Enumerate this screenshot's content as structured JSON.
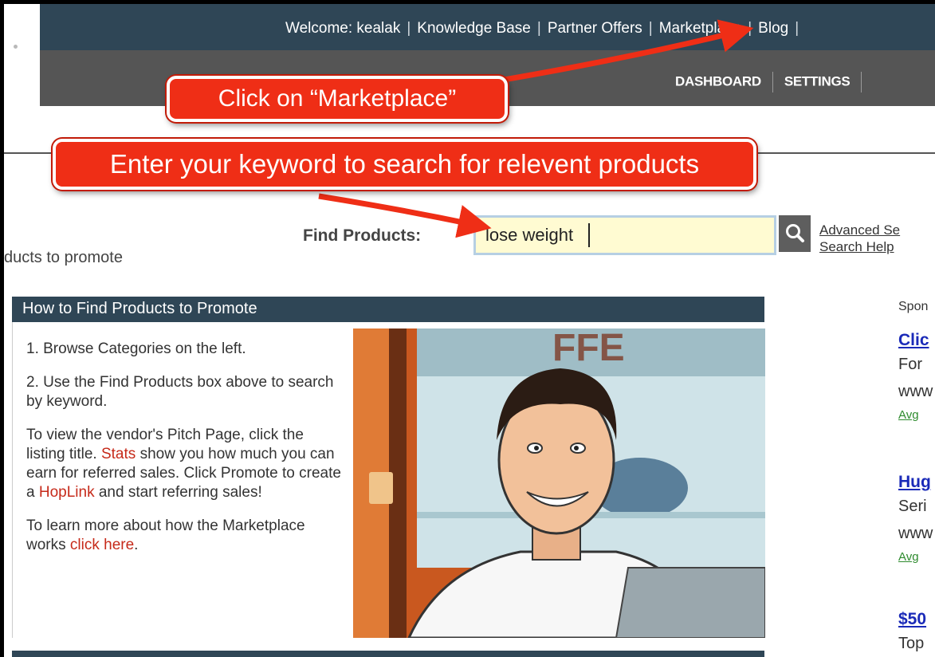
{
  "topnav": {
    "items": [
      "Welcome: kealak",
      "Knowledge Base",
      "Partner Offers",
      "Marketplace",
      "Blog"
    ],
    "separator": "|"
  },
  "subnav": {
    "items": [
      "DASHBOARD",
      "SETTINGS"
    ]
  },
  "callouts": {
    "marketplace": "Click on “Marketplace”",
    "search": "Enter your keyword to search for relevent products"
  },
  "search": {
    "label": "Find Products:",
    "value": "lose weight",
    "button_icon": "search-icon",
    "links": [
      "Advanced Se",
      "Search Help"
    ]
  },
  "page": {
    "subtitle": "ducts to promote"
  },
  "howto": {
    "title": "How to Find Products to Promote",
    "step1": "1. Browse Categories on the left.",
    "step2": "2. Use the Find Products box above to search by keyword.",
    "p3_a": "To view the vendor's Pitch Page, click the listing title. ",
    "p3_stats": "Stats",
    "p3_b": " show you how much you can earn for referred sales. Click Promote to create a ",
    "p3_hoplink": "HopLink",
    "p3_c": " and start referring sales!",
    "p4_a": "To learn more about how the Marketplace works ",
    "p4_link": "click here",
    "p4_b": "."
  },
  "sponsored": {
    "label": "Spon",
    "ads": [
      {
        "title": "Clic",
        "line1": "For",
        "line2": "www",
        "small": "Avg"
      },
      {
        "title": "Hug",
        "line1": "Seri",
        "line2": "www",
        "small": "Avg"
      },
      {
        "title": "$50",
        "line1": "Top",
        "line2": "",
        "small": ""
      }
    ]
  },
  "colors": {
    "nav_dark": "#2f4656",
    "nav_gray": "#555555",
    "callout_red": "#ef2e16",
    "ad_link": "#1a2ab8"
  }
}
